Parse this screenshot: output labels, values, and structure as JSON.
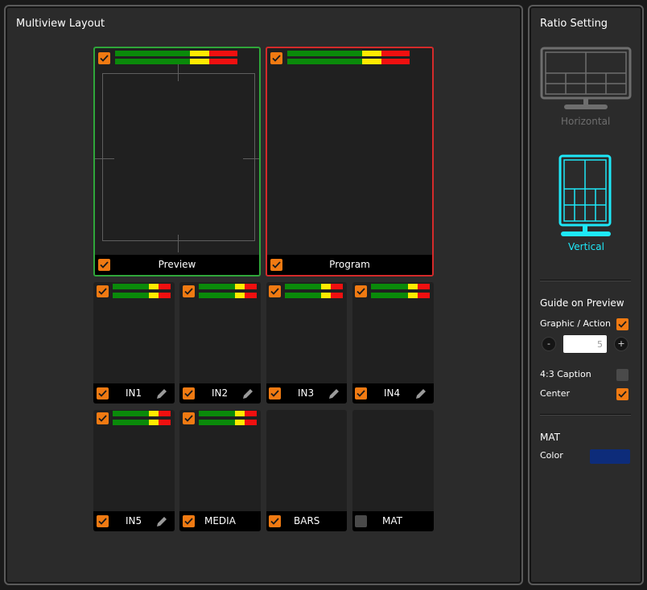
{
  "layout_panel": {
    "title": "Multiview Layout"
  },
  "ratio_panel": {
    "title": "Ratio Setting",
    "options": [
      {
        "label": "Horizontal",
        "selected": false
      },
      {
        "label": "Vertical",
        "selected": true
      }
    ],
    "accent_color": "#1ee8f8",
    "inactive_color": "#6e6e6e"
  },
  "tiles": [
    {
      "label": "Preview",
      "checked": true,
      "meter": true,
      "editable": false
    },
    {
      "label": "Program",
      "checked": true,
      "meter": true,
      "editable": false
    },
    {
      "label": "IN1",
      "checked": true,
      "meter": true,
      "editable": true
    },
    {
      "label": "IN2",
      "checked": true,
      "meter": true,
      "editable": true
    },
    {
      "label": "IN3",
      "checked": true,
      "meter": true,
      "editable": true
    },
    {
      "label": "IN4",
      "checked": true,
      "meter": true,
      "editable": true
    },
    {
      "label": "IN5",
      "checked": true,
      "meter": true,
      "editable": true
    },
    {
      "label": "MEDIA",
      "checked": true,
      "meter": true,
      "editable": false
    },
    {
      "label": "BARS",
      "checked": true,
      "meter": false,
      "editable": false
    },
    {
      "label": "MAT",
      "checked": false,
      "meter": false,
      "editable": false
    }
  ],
  "guide": {
    "title": "Guide on Preview",
    "graphic_action": {
      "label": "Graphic / Action",
      "checked": true
    },
    "stepper": {
      "minus": "-",
      "value": "5",
      "plus": "+"
    },
    "caption": {
      "label": "4:3 Caption",
      "checked": false
    },
    "center": {
      "label": "Center",
      "checked": true
    }
  },
  "mat": {
    "title": "MAT",
    "color_label": "Color",
    "color_value": "#0d2c7a"
  },
  "colors": {
    "checkbox_on": "#f07a12",
    "checkbox_off": "#4a4a4a",
    "preview_border": "#2fa63a",
    "program_border": "#d42a2a"
  }
}
